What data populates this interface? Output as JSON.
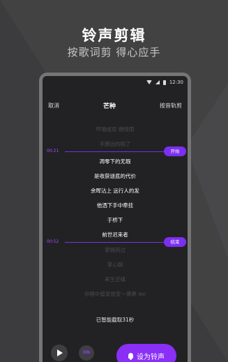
{
  "hero": {
    "title": "铃声剪辑",
    "subtitle": "按歌词剪 得心应手"
  },
  "status_bar": {
    "time": "12:30"
  },
  "topbar": {
    "cancel_label": "取消",
    "song_title": "芒种",
    "mode_label": "按音轨剪"
  },
  "markers": {
    "start": {
      "time": "00:21",
      "label": "开始"
    },
    "end": {
      "time": "00:52",
      "label": "结束"
    }
  },
  "lyrics": {
    "before": [
      "哼唱成双 缠情雨",
      "手腕远的桃了"
    ],
    "selected": [
      "凋零下的无瑕",
      "是收获谜底的代价",
      "余晖沾上 远行人的发",
      "他洒下手中牵挂",
      "于桥下",
      "前世迟来者"
    ],
    "after": [
      "掌隔而过",
      "掌心朝",
      "来生还嗔",
      "你唱中留发放变一袭裹 wo"
    ]
  },
  "auto_note": "已智能截取31秒",
  "controls": {
    "on_label": "ON",
    "set_ringtone_label": "设为铃声"
  },
  "colors": {
    "accent": "#8a2ff5",
    "marker_time": "#a64dff"
  }
}
